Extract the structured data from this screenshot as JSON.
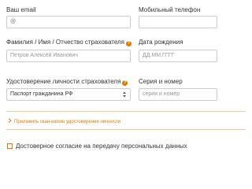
{
  "email": {
    "label": "Ваш email",
    "value": "@"
  },
  "phone": {
    "label": "Мобильный телефон",
    "value": ""
  },
  "full_name": {
    "label": "Фамилия / Имя / Отчество страхователя",
    "placeholder": "Петров Алексей Иванович"
  },
  "birth_date": {
    "label": "Дата рождения",
    "placeholder": "ДД.ММ.ГГГГ"
  },
  "identity_doc": {
    "label": "Удостоверение личности страхователя",
    "selected": "Паспорт гражданина РФ"
  },
  "series_number": {
    "label": "Серия и номер",
    "placeholder": "серия и номер"
  },
  "attach_scan": {
    "label": "Приложить скан-копию удостоверения личности"
  },
  "consent": {
    "label": "Достоверное согласие на передачу персональных данных",
    "checked": false
  },
  "colors": {
    "accent": "#e07a00",
    "border": "#cccccc",
    "divider": "#f3c79a"
  },
  "icons": {
    "help": "question-circle-icon",
    "expand": "chevron-right-icon",
    "select": "select-arrows-icon"
  }
}
